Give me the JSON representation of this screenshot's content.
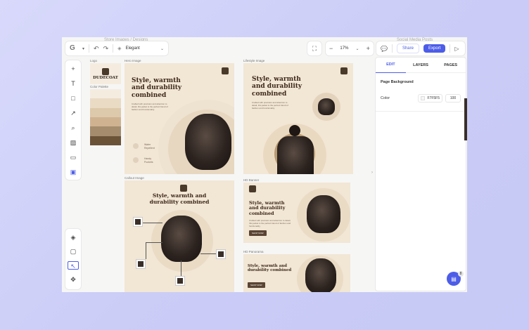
{
  "canvas_ghost_labels": {
    "left": "Store Images / Designs",
    "right": "Social Media Posts"
  },
  "topbar": {
    "theme_name": "Elegant",
    "zoom": "17%",
    "share_label": "Share",
    "export_label": "Export"
  },
  "tools_top": [
    "plus-icon",
    "text-icon",
    "square-icon",
    "pen-icon",
    "shapes-icon",
    "image-icon",
    "video-icon",
    "ai-icon"
  ],
  "tools_bottom": [
    "layers-icon",
    "frame-icon",
    "select-icon",
    "move-icon"
  ],
  "canvas": {
    "logo_label": "Logo",
    "palette_label": "Color Palette",
    "hero_label": "Hero Image",
    "lifestyle_label": "Lifestyle Image",
    "callout_label": "Callout Image",
    "hd_banner_label": "HD Banner",
    "hd_panorama_label": "HD Panorama",
    "brand": "DUDECOAT",
    "headline": "Style, warmth and durability combined",
    "body": "Crafted with precision and attention to detail, this jacket is the perfect blend of fashion and functionality.",
    "feature_1": "Water Repellent",
    "feature_2": "Handy Pockets",
    "cta": "SHOP NOW"
  },
  "palette_colors": [
    "#f5ece0",
    "#eadbc5",
    "#ddc9ab",
    "#cfb391",
    "#a48c6c",
    "#6b5338"
  ],
  "properties": {
    "tabs": [
      "EDIT",
      "LAYERS",
      "PAGES"
    ],
    "section": "Page Background",
    "color_label": "Color",
    "color_value": "F7F5F5",
    "opacity": "100"
  },
  "help_badge": "8"
}
